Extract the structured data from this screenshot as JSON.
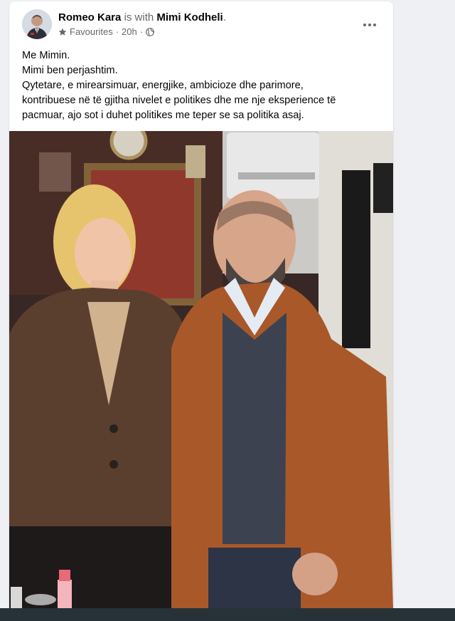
{
  "post": {
    "author": "Romeo Kara",
    "with_text": "is with",
    "tagged": "Mimi Kodheli",
    "period": ".",
    "audience": "Favourites",
    "separator": "·",
    "time": "20h",
    "privacy_icon": "globe-icon",
    "more_icon": "more-horizontal-icon",
    "text_lines": [
      "Me Mimin.",
      "Mimi ben perjashtim.",
      "Qytetare, e mirearsimuar, energjike, ambicioze dhe parimore,",
      "kontribuese në të gjitha nivelet e politikes dhe me nje eksperience të",
      "pacmuar, ajo sot i duhet politikes me teper se sa politika asaj."
    ]
  },
  "colors": {
    "page_bg": "#eef0f4",
    "card_bg": "#ffffff",
    "secondary_text": "#65676b",
    "taskbar": "#263238"
  }
}
